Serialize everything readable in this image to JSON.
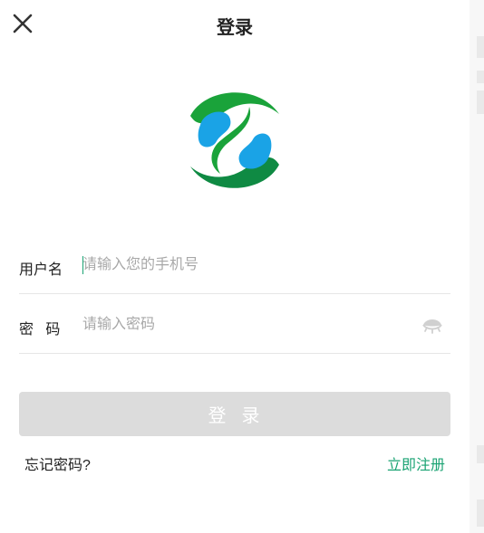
{
  "header": {
    "title": "登录",
    "close_icon": "close-icon"
  },
  "logo": {
    "icon": "brand-logo-icon",
    "colors": {
      "green": "#1aa33a",
      "dark_green": "#0f8a43",
      "blue": "#1aa3e6"
    }
  },
  "form": {
    "username": {
      "label": "用户名",
      "placeholder": "请输入您的手机号",
      "value": ""
    },
    "password": {
      "label": "密   码",
      "placeholder": "请输入密码",
      "value": "",
      "toggle_icon": "eye-closed-icon"
    }
  },
  "actions": {
    "login_label": "登  录",
    "forgot_label": "忘记密码?",
    "register_label": "立即注册"
  },
  "colors": {
    "accent": "#1aa373",
    "button_disabled": "#dcdcdc",
    "divider": "#e6e6e6"
  }
}
